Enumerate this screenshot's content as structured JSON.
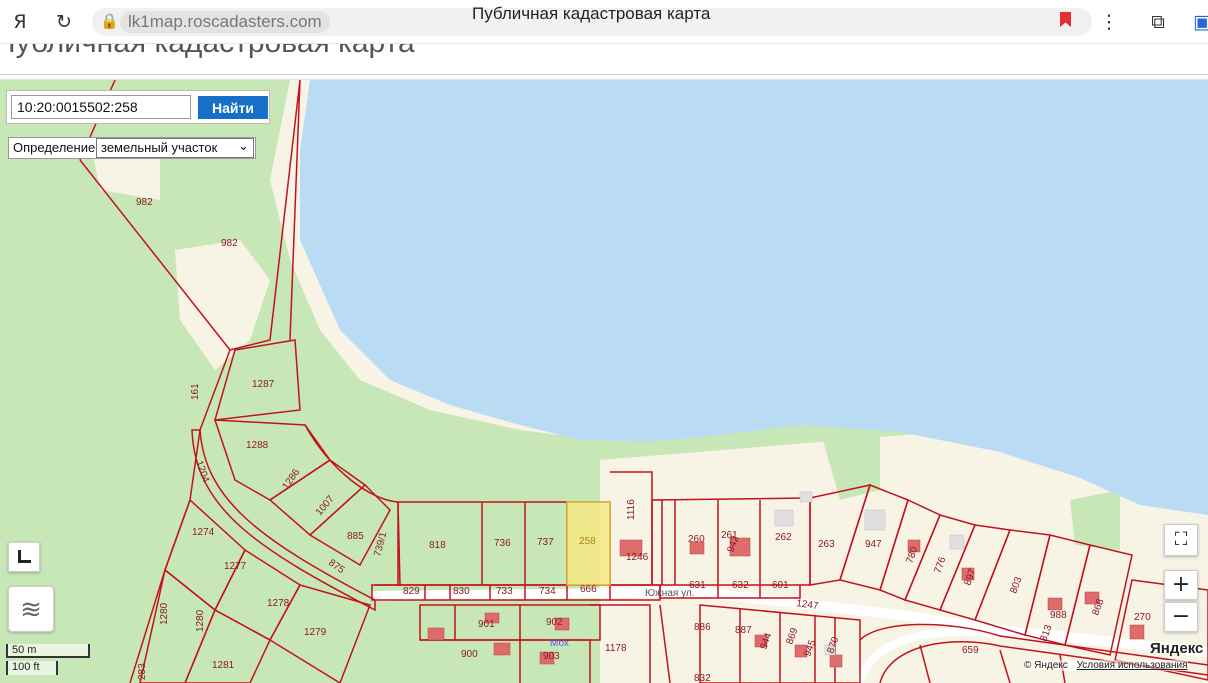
{
  "browser": {
    "url": "lk1map.roscadasters.com",
    "page_title": "Публичная кадастровая карта"
  },
  "site": {
    "heading": "Публичная кадастровая карта"
  },
  "search": {
    "value": "10:20:0015502:258",
    "button_label": "Найти"
  },
  "definition": {
    "label": "Определение:",
    "selected": "земельный участок"
  },
  "map": {
    "street_label": "Южная ул.",
    "poi_label": "Мох",
    "selected_parcel": "258",
    "scale_metric": "50 m",
    "scale_imperial": "100 ft",
    "copyright": "© Яндекс",
    "terms": "Условия использования",
    "logo_text": "Яндекс",
    "zoom_in": "+",
    "zoom_out": "−",
    "colors": {
      "water": "#b9dcf4",
      "forest": "#c8e7b7",
      "sand": "#f7f4e6",
      "parcel_line": "#c3121f",
      "selected_fill": "#f6e985",
      "building": "#e06b6b"
    },
    "parcel_labels": [
      "982",
      "982",
      "161",
      "1287",
      "1288",
      "1286",
      "1204",
      "1007",
      "885",
      "739/1",
      "875",
      "818",
      "736",
      "737",
      "258",
      "1116",
      "1246",
      "260",
      "261",
      "942",
      "262",
      "263",
      "947",
      "780",
      "776",
      "897",
      "803",
      "988",
      "868",
      "270",
      "1274",
      "1277",
      "1278",
      "1280",
      "1280",
      "1279",
      "1281",
      "283",
      "829",
      "830",
      "733",
      "734",
      "666",
      "631",
      "632",
      "601",
      "1247",
      "659",
      "813",
      "901",
      "902",
      "900",
      "903",
      "1178",
      "886",
      "887",
      "944",
      "869",
      "945",
      "870",
      "832"
    ]
  }
}
